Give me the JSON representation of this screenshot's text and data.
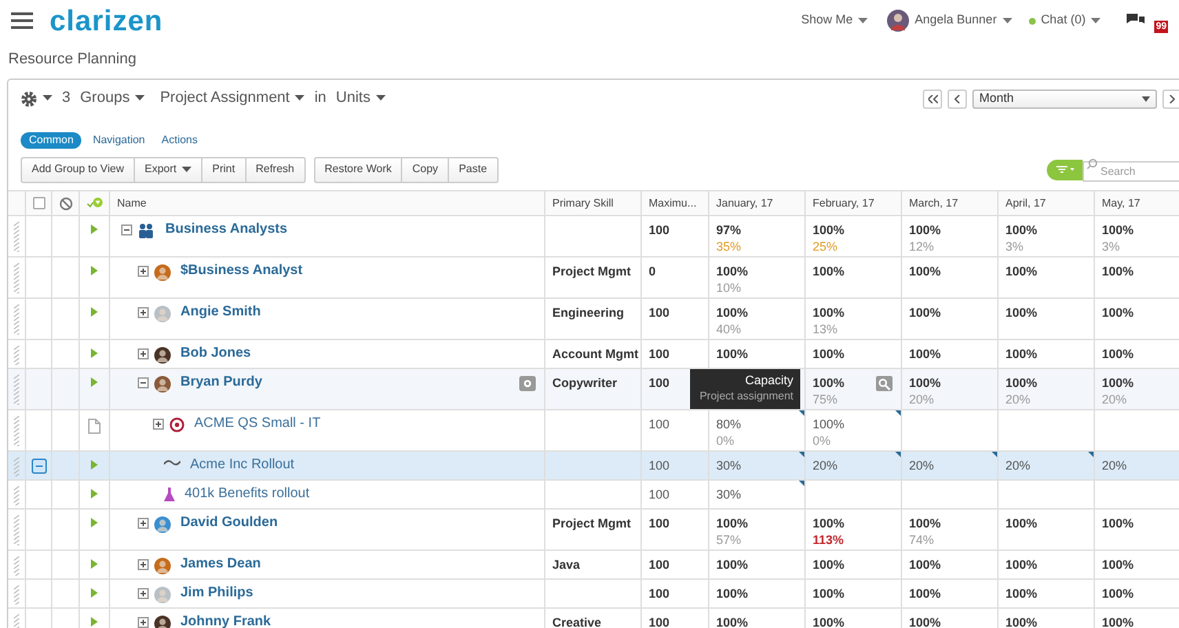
{
  "topbar": {
    "logo": "clarizen",
    "show_me": "Show Me",
    "user": "Angela Bunner",
    "chat": "Chat (0)",
    "notifications": "99"
  },
  "page_title": "Resource Planning",
  "toolbar": {
    "count": "3",
    "groups": "Groups",
    "grouping": "Project Assignment",
    "in": "in",
    "units": "Units",
    "period": "Month"
  },
  "tabs": [
    {
      "label": "Common",
      "selected": true
    },
    {
      "label": "Navigation",
      "selected": false
    },
    {
      "label": "Actions",
      "selected": false
    }
  ],
  "button_groups": [
    [
      {
        "label": "Add Group to View",
        "menu": false
      },
      {
        "label": "Export",
        "menu": true
      },
      {
        "label": "Print",
        "menu": false
      },
      {
        "label": "Refresh",
        "menu": false
      }
    ],
    [
      {
        "label": "Restore Work",
        "menu": false
      },
      {
        "label": "Copy",
        "menu": false
      },
      {
        "label": "Paste",
        "menu": false
      }
    ]
  ],
  "search": {
    "placeholder": "Search"
  },
  "select_all": {
    "checked": false
  },
  "columns": [
    "Name",
    "Primary Skill",
    "Maximu...",
    "January, 17",
    "February, 17",
    "March, 17",
    "April, 17",
    "May, 17"
  ],
  "tooltip": {
    "title": "Capacity",
    "subtitle": "Project assignment"
  },
  "rows": [
    {
      "kind": "group",
      "name": "Business Analysts",
      "expanded": true,
      "selected": false,
      "hovered": false,
      "max": "100",
      "cells": [
        {
          "value": "97%",
          "sub": "35%",
          "color": "#e09b22",
          "flagged": false
        },
        {
          "value": "100%",
          "sub": "25%",
          "color": "#e09b22",
          "flagged": false
        },
        {
          "value": "100%",
          "sub": "12%",
          "color": "#999999",
          "flagged": false
        },
        {
          "value": "100%",
          "sub": "3%",
          "color": "#999999",
          "flagged": false
        },
        {
          "value": "100%",
          "sub": "3%",
          "color": "#999999",
          "flagged": false
        }
      ],
      "children": [
        {
          "kind": "resource",
          "name": "$Business Analyst",
          "expanded": false,
          "selected": false,
          "hovered": false,
          "skill": "Project Mgmt",
          "max": "0",
          "cells": [
            {
              "value": "100%",
              "sub": "10%",
              "color": "#999999",
              "flagged": false
            },
            {
              "value": "100%",
              "flagged": false
            },
            {
              "value": "100%",
              "flagged": false
            },
            {
              "value": "100%",
              "flagged": false
            },
            {
              "value": "100%",
              "flagged": false
            }
          ]
        },
        {
          "kind": "resource",
          "name": "Angie Smith",
          "expanded": false,
          "selected": false,
          "hovered": false,
          "skill": "Engineering",
          "max": "100",
          "cells": [
            {
              "value": "100%",
              "sub": "40%",
              "color": "#999999",
              "flagged": false
            },
            {
              "value": "100%",
              "sub": "13%",
              "color": "#999999",
              "flagged": false
            },
            {
              "value": "100%",
              "flagged": false
            },
            {
              "value": "100%",
              "flagged": false
            },
            {
              "value": "100%",
              "flagged": false
            }
          ]
        },
        {
          "kind": "resource",
          "name": "Bob Jones",
          "expanded": false,
          "selected": false,
          "hovered": false,
          "skill": "Account Mgmt",
          "max": "100",
          "cells": [
            {
              "value": "100%",
              "flagged": false
            },
            {
              "value": "100%",
              "flagged": false
            },
            {
              "value": "100%",
              "flagged": false
            },
            {
              "value": "100%",
              "flagged": false
            },
            {
              "value": "100%",
              "flagged": false
            }
          ]
        },
        {
          "kind": "resource",
          "name": "Bryan Purdy",
          "expanded": true,
          "selected": false,
          "hovered": true,
          "skill": "Copywriter",
          "max": "100",
          "cells": [
            null,
            {
              "value": "100%",
              "sub": "75%",
              "color": "#999999",
              "flagged": false
            },
            {
              "value": "100%",
              "sub": "20%",
              "color": "#999999",
              "flagged": false
            },
            {
              "value": "100%",
              "sub": "20%",
              "color": "#999999",
              "flagged": false
            },
            {
              "value": "100%",
              "sub": "20%",
              "color": "#999999",
              "flagged": false
            }
          ],
          "children": [
            {
              "kind": "file_project",
              "name": "ACME QS Small - IT",
              "expanded": false,
              "selected": false,
              "hovered": false,
              "max": "100",
              "cells": [
                {
                  "value": "80%",
                  "sub": "0%",
                  "color": "#999999",
                  "flagged": true
                },
                {
                  "value": "100%",
                  "sub": "0%",
                  "color": "#999999",
                  "flagged": true
                },
                null,
                null,
                null
              ]
            },
            {
              "kind": "project",
              "name": "Acme Inc Rollout",
              "selected": true,
              "hovered": false,
              "max": "100",
              "cells": [
                {
                  "value": "30%",
                  "flagged": true
                },
                {
                  "value": "20%",
                  "flagged": true
                },
                {
                  "value": "20%",
                  "flagged": true
                },
                {
                  "value": "20%",
                  "flagged": true
                },
                {
                  "value": "20%",
                  "flagged": false
                }
              ]
            },
            {
              "kind": "project",
              "name": "401k Benefits rollout",
              "selected": false,
              "hovered": false,
              "max": "100",
              "cells": [
                {
                  "value": "30%",
                  "flagged": true
                },
                null,
                null,
                null,
                null
              ]
            }
          ]
        },
        {
          "kind": "resource",
          "name": "David Goulden",
          "expanded": false,
          "selected": false,
          "hovered": false,
          "skill": "Project Mgmt",
          "max": "100",
          "cells": [
            {
              "value": "100%",
              "sub": "57%",
              "color": "#999999",
              "flagged": false
            },
            {
              "value": "100%",
              "sub": "113%",
              "color": "#c0272d",
              "flagged": false
            },
            {
              "value": "100%",
              "sub": "74%",
              "color": "#999999",
              "flagged": false
            },
            {
              "value": "100%",
              "flagged": false
            },
            {
              "value": "100%",
              "flagged": false
            }
          ]
        },
        {
          "kind": "resource",
          "name": "James Dean",
          "expanded": false,
          "selected": false,
          "hovered": false,
          "skill": "Java",
          "max": "100",
          "cells": [
            {
              "value": "100%",
              "flagged": false
            },
            {
              "value": "100%",
              "flagged": false
            },
            {
              "value": "100%",
              "flagged": false
            },
            {
              "value": "100%",
              "flagged": false
            },
            {
              "value": "100%",
              "flagged": false
            }
          ]
        },
        {
          "kind": "resource",
          "name": "Jim Philips",
          "expanded": false,
          "selected": false,
          "hovered": false,
          "max": "100",
          "cells": [
            {
              "value": "100%",
              "flagged": false
            },
            {
              "value": "100%",
              "flagged": false
            },
            {
              "value": "100%",
              "flagged": false
            },
            {
              "value": "100%",
              "flagged": false
            },
            {
              "value": "100%",
              "flagged": false
            }
          ]
        },
        {
          "kind": "resource",
          "name": "Johnny Frank",
          "expanded": false,
          "selected": false,
          "hovered": false,
          "skill": "Creative",
          "max": "100",
          "cells": [
            {
              "value": "100%",
              "flagged": false
            },
            {
              "value": "100%",
              "flagged": false
            },
            {
              "value": "100%",
              "flagged": false
            },
            {
              "value": "100%",
              "flagged": false
            },
            {
              "value": "100%",
              "flagged": false
            }
          ]
        }
      ]
    }
  ]
}
